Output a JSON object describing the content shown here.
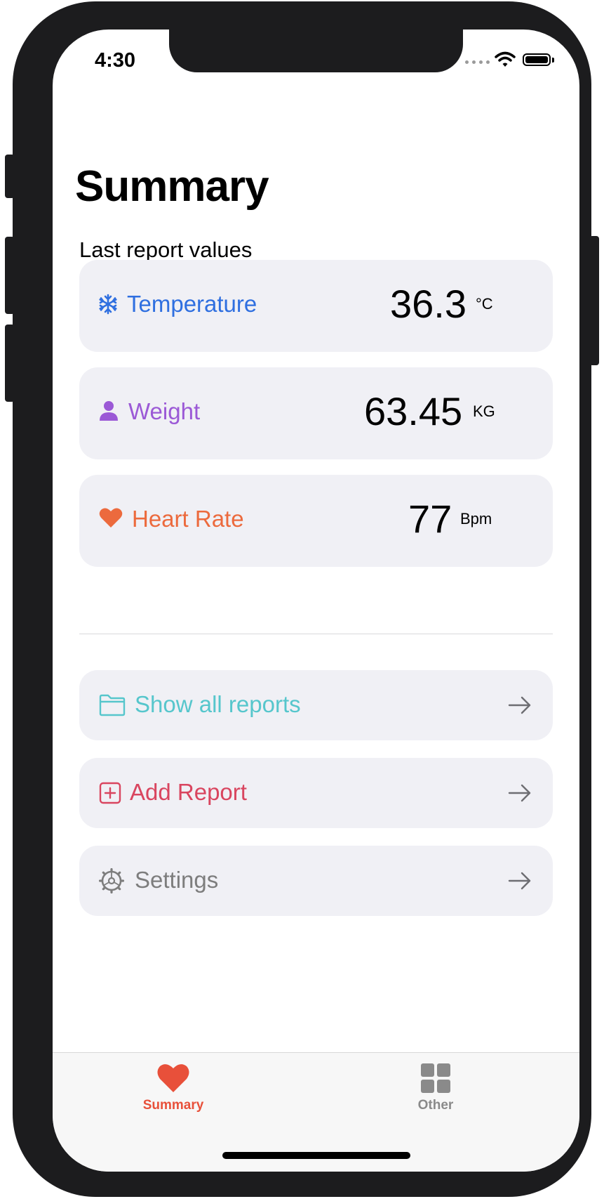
{
  "status_bar": {
    "time": "4:30"
  },
  "header": {
    "title": "Summary",
    "subtitle": "Last report values"
  },
  "metrics": [
    {
      "label": "Temperature",
      "value": "36.3",
      "unit": "°C",
      "icon": "snowflake-icon",
      "color": "#2f6fe0"
    },
    {
      "label": "Weight",
      "value": "63.45",
      "unit": "KG",
      "icon": "person-icon",
      "color": "#9b59d6"
    },
    {
      "label": "Heart Rate",
      "value": "77",
      "unit": "Bpm",
      "icon": "heart-icon",
      "color": "#ec6a3d"
    }
  ],
  "menu": [
    {
      "label": "Show all reports",
      "icon": "folder-icon",
      "color": "#56c6cc"
    },
    {
      "label": "Add Report",
      "icon": "plus-square-icon",
      "color": "#d9455f"
    },
    {
      "label": "Settings",
      "icon": "gear-icon",
      "color": "#7d7d7d"
    }
  ],
  "tabbar": {
    "items": [
      {
        "label": "Summary",
        "icon": "heart-icon",
        "selected": true,
        "color": "#e8503a"
      },
      {
        "label": "Other",
        "icon": "grid-icon",
        "selected": false,
        "color": "#8a8a8a"
      }
    ]
  }
}
